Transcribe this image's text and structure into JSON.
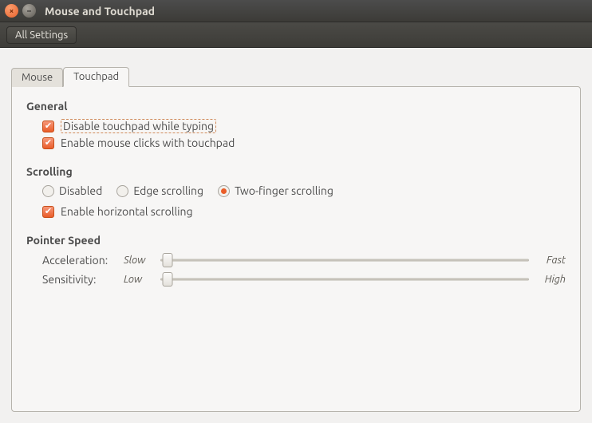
{
  "window": {
    "title": "Mouse and Touchpad"
  },
  "toolbar": {
    "all_settings": "All Settings"
  },
  "tabs": {
    "mouse": "Mouse",
    "touchpad": "Touchpad",
    "active": "touchpad"
  },
  "general": {
    "title": "General",
    "disable_while_typing": {
      "label": "Disable touchpad while typing",
      "checked": true
    },
    "enable_clicks": {
      "label": "Enable mouse clicks with touchpad",
      "checked": true
    }
  },
  "scrolling": {
    "title": "Scrolling",
    "options": {
      "disabled": "Disabled",
      "edge": "Edge scrolling",
      "two_finger": "Two-finger scrolling"
    },
    "selected": "two_finger",
    "horizontal": {
      "label": "Enable horizontal scrolling",
      "checked": true
    }
  },
  "pointer_speed": {
    "title": "Pointer Speed",
    "acceleration": {
      "label": "Acceleration:",
      "low": "Slow",
      "high": "Fast",
      "value_pct": 2
    },
    "sensitivity": {
      "label": "Sensitivity:",
      "low": "Low",
      "high": "High",
      "value_pct": 2
    }
  }
}
